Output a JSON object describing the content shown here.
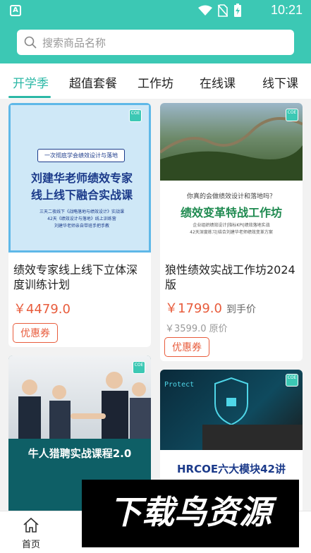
{
  "status_bar": {
    "app_badge": "A",
    "time": "10:21"
  },
  "search": {
    "placeholder": "搜索商品名称"
  },
  "tabs": [
    {
      "label": "开学季"
    },
    {
      "label": "超值套餐"
    },
    {
      "label": "工作坊"
    },
    {
      "label": "在线课"
    },
    {
      "label": "线下课"
    }
  ],
  "cards": [
    {
      "image_text": {
        "pill": "一次彻底学会绩效设计与落地",
        "headline_1": "刘建华老师绩效专家",
        "headline_2": "线上线下融合实战课",
        "line_1": "三天二夜线下《战略落地与绩效设计》实战课",
        "line_2": "42天《绩效设计与落地》线上训练营",
        "line_3": "刘建华老师亲自带班手把手教"
      },
      "title": "绩效专家线上线下立体深度训练计划",
      "price": "￥4479.0",
      "coupon": "优惠券"
    },
    {
      "image_text": {
        "question": "你真的会做绩效设计和落地吗？",
        "headline": "绩效变革特战工作坊",
        "line_1": "企业组织绩效设计|指标KPI|绩效落地实战",
        "line_2": "42天深度练习|结合刘建华老师绩效变革方案"
      },
      "title": "狼性绩效实战工作坊2024版",
      "price": "￥1799.0",
      "price_note": "到手价",
      "original_price": "￥3599.0 原价",
      "coupon": "优惠券"
    },
    {
      "image_text": {
        "headline": "牛人猎聘实战课程2.0"
      }
    },
    {
      "image_text": {
        "screen_word": "Protect",
        "headline": "HRCOE六大模块42讲"
      }
    }
  ],
  "badge_text": "COE",
  "nav": {
    "home_label": "首页"
  },
  "watermark": {
    "text": "下载鸟资源"
  },
  "colors": {
    "brand": "#3cc8b4",
    "accent": "#2cb8a6",
    "price": "#e85c3c"
  }
}
